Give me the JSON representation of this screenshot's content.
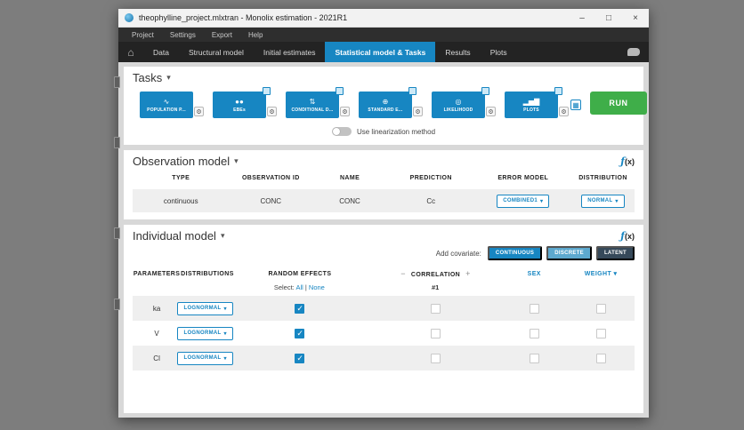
{
  "window": {
    "title": "theophylline_project.mlxtran - Monolix estimation - 2021R1",
    "controls": {
      "minimize": "–",
      "maximize": "□",
      "close": "×"
    }
  },
  "menubar": {
    "items": [
      "Project",
      "Settings",
      "Export",
      "Help"
    ]
  },
  "tabbar": {
    "tabs": [
      "Data",
      "Structural model",
      "Initial estimates",
      "Statistical model & Tasks",
      "Results",
      "Plots"
    ],
    "active": "Statistical model & Tasks"
  },
  "icons": {
    "home": "⌂",
    "chevron": "▾",
    "wrench": "⚙",
    "grid": "▦",
    "list": "≡",
    "fx_f": "ƒ",
    "fx_x": "(x)"
  },
  "colors": {
    "accent_blue": "#1786C2",
    "run_green": "#3FAE49",
    "discrete_blue": "#5DA9CF",
    "latent_dark": "#36495A"
  },
  "tasks": {
    "title": "Tasks",
    "buttons": [
      {
        "label": "POPULATION P...",
        "icon": "∿"
      },
      {
        "label": "EBEs",
        "icon": "●●"
      },
      {
        "label": "CONDITIONAL D...",
        "icon": "⇅"
      },
      {
        "label": "STANDARD E...",
        "icon": "⊕"
      },
      {
        "label": "LIKELIHOOD",
        "icon": "◎"
      },
      {
        "label": "PLOTS",
        "icon": "▂▅▇"
      }
    ],
    "run_label": "RUN",
    "linearization_label": "Use linearization method"
  },
  "observation_model": {
    "title": "Observation model",
    "columns": [
      "TYPE",
      "OBSERVATION ID",
      "NAME",
      "PREDICTION",
      "ERROR MODEL",
      "DISTRIBUTION"
    ],
    "rows": [
      {
        "type": "continuous",
        "observation_id": "CONC",
        "name": "CONC",
        "prediction": "Cc",
        "error_model": "COMBINED1",
        "distribution": "NORMAL"
      }
    ]
  },
  "individual_model": {
    "title": "Individual model",
    "add_covariate_label": "Add covariate:",
    "covariate_buttons": [
      "CONTINUOUS",
      "DISCRETE",
      "LATENT"
    ],
    "columns": {
      "parameters": "PARAMETERS",
      "distributions": "DISTRIBUTIONS",
      "random_effects": "RANDOM EFFECTS",
      "correlation": "CORRELATION",
      "sex": "SEX",
      "weight": "WEIGHT"
    },
    "correlation_minus": "−",
    "correlation_plus": "+",
    "select_label": "Select:",
    "select_all": "All",
    "select_divider": "|",
    "select_none": "None",
    "correlation_group": "#1",
    "rows": [
      {
        "parameter": "ka",
        "distribution": "LOGNORMAL",
        "random_effect": true,
        "correlation": false,
        "sex": false,
        "weight": false
      },
      {
        "parameter": "V",
        "distribution": "LOGNORMAL",
        "random_effect": true,
        "correlation": false,
        "sex": false,
        "weight": false
      },
      {
        "parameter": "Cl",
        "distribution": "LOGNORMAL",
        "random_effect": true,
        "correlation": false,
        "sex": false,
        "weight": false
      }
    ]
  }
}
